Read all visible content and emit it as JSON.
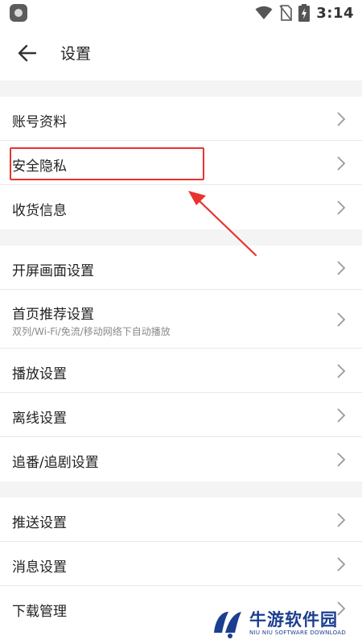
{
  "status_bar": {
    "time": "3:14",
    "icons": [
      "app-notification-icon",
      "wifi-icon",
      "no-sim-icon",
      "battery-charging-icon"
    ]
  },
  "header": {
    "title": "设置",
    "back_icon": "arrow-left-icon"
  },
  "groups": [
    {
      "items": [
        {
          "label": "账号资料",
          "subtitle": ""
        },
        {
          "label": "安全隐私",
          "subtitle": ""
        },
        {
          "label": "收货信息",
          "subtitle": ""
        }
      ]
    },
    {
      "items": [
        {
          "label": "开屏画面设置",
          "subtitle": ""
        },
        {
          "label": "首页推荐设置",
          "subtitle": "双列/Wi-Fi/免流/移动网络下自动播放"
        },
        {
          "label": "播放设置",
          "subtitle": ""
        },
        {
          "label": "离线设置",
          "subtitle": ""
        },
        {
          "label": "追番/追剧设置",
          "subtitle": ""
        }
      ]
    },
    {
      "items": [
        {
          "label": "推送设置",
          "subtitle": ""
        },
        {
          "label": "消息设置",
          "subtitle": ""
        },
        {
          "label": "下载管理",
          "subtitle": ""
        }
      ]
    }
  ],
  "annotation": {
    "highlighted_item": "安全隐私",
    "color": "#e8332f"
  },
  "watermark": {
    "name": "牛游软件园",
    "subtitle": "NIU NIU SOFTWARE DOWNLOAD",
    "color": "#1b3e8f"
  },
  "colors": {
    "background": "#f4f4f4",
    "surface": "#ffffff",
    "divider": "#e8e8e8",
    "subtitle_text": "#8a8a8a"
  }
}
